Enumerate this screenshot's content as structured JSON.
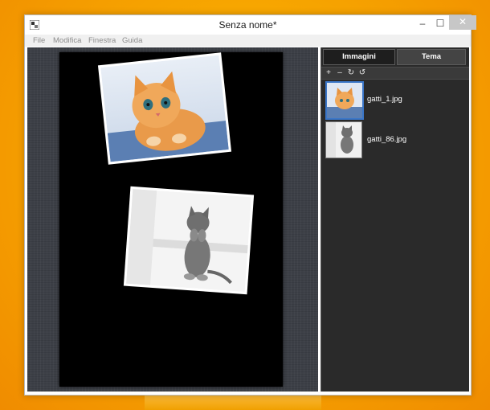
{
  "window": {
    "title": "Senza nome*",
    "controls": {
      "minimize": "–",
      "maximize": "☐",
      "close": "✕"
    }
  },
  "menubar": {
    "items": [
      "File",
      "Modifica",
      "Finestra",
      "Guida"
    ]
  },
  "panel": {
    "tabs": [
      "Immagini",
      "Tema"
    ],
    "active_tab": "Immagini",
    "toolbar": [
      "+",
      "–",
      "↻",
      "↺"
    ],
    "files": [
      {
        "name": "gatti_1.jpg",
        "thumb": "kitten-orange"
      },
      {
        "name": "gatti_86.jpg",
        "thumb": "kitten-tabby"
      }
    ]
  },
  "colors": {
    "desktop": "#f7a600",
    "workspace": "#3d4047",
    "page": "#000000",
    "panel": "#2a2a2a",
    "selection": "#3a76c8"
  }
}
